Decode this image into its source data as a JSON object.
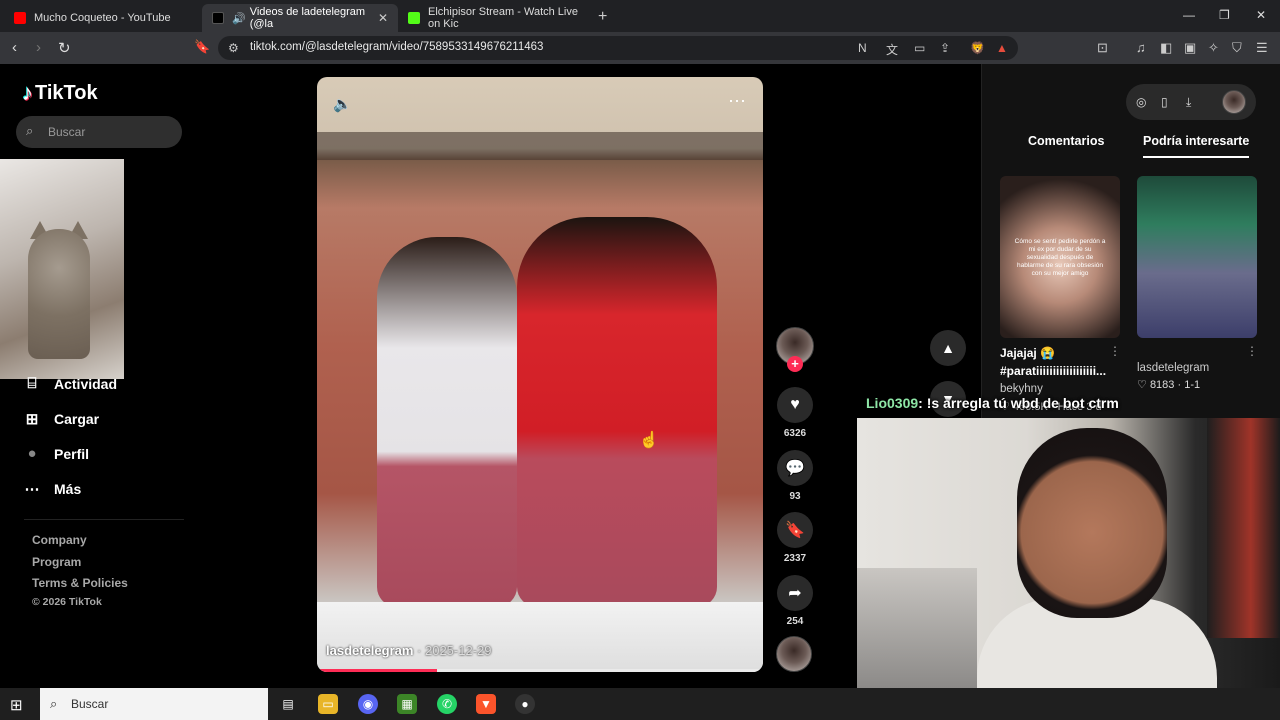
{
  "browser": {
    "tabs": [
      {
        "title": "Mucho Coqueteo - YouTube",
        "color": "#ff0000",
        "active": false
      },
      {
        "title": "Videos de ladetelegram (@la",
        "color": "#000000",
        "active": true,
        "close": "✕"
      },
      {
        "title": "Elchipisor Stream - Watch Live on Kic",
        "color": "#53fc18",
        "active": false
      }
    ],
    "new_tab": "+",
    "url": "tiktok.com/@lasdetelegram/video/7589533149676211463"
  },
  "tiktok": {
    "logo": "TikTok",
    "search_placeholder": "Buscar",
    "nav": [
      {
        "label": "Actividad",
        "icon": "activity-icon",
        "glyph": "⌸"
      },
      {
        "label": "Cargar",
        "icon": "upload-icon",
        "glyph": "⊞"
      },
      {
        "label": "Perfil",
        "icon": "profile-icon",
        "glyph": "●"
      },
      {
        "label": "Más",
        "icon": "more-icon",
        "glyph": "⋯"
      }
    ],
    "footer": [
      "Company",
      "Program",
      "Terms & Policies",
      "© 2026 TikTok"
    ]
  },
  "video": {
    "author": "lasdetelegram",
    "date": " · 2025-12-29",
    "progress": 0.27,
    "likes": "6326",
    "comments": "93",
    "saves": "2337",
    "shares": "254"
  },
  "right_panel": {
    "tabs": [
      "Comentarios",
      "Podría interesarte"
    ],
    "active_tab": 1,
    "items": [
      {
        "overlay": "Cómo se sentí pedirle perdón a mi ex por dudar de su sexualidad después de hablarme de su rara obsesión con su mejor amigo",
        "title_line1": "Jajajaj 😭",
        "title_line2": "#paratiiiiiiiiiiiiiiiiii...",
        "user": "bekyhny",
        "likes": "466.5K",
        "time": "Hace 3 d"
      },
      {
        "user": "lasdetelegram",
        "likes": "8183",
        "time": "1-1"
      }
    ]
  },
  "stream": {
    "chat_user": "Lio0309",
    "chat_message": ": !s arregla tú wbd de bot ctrm"
  },
  "taskbar": {
    "search_placeholder": "Buscar"
  }
}
